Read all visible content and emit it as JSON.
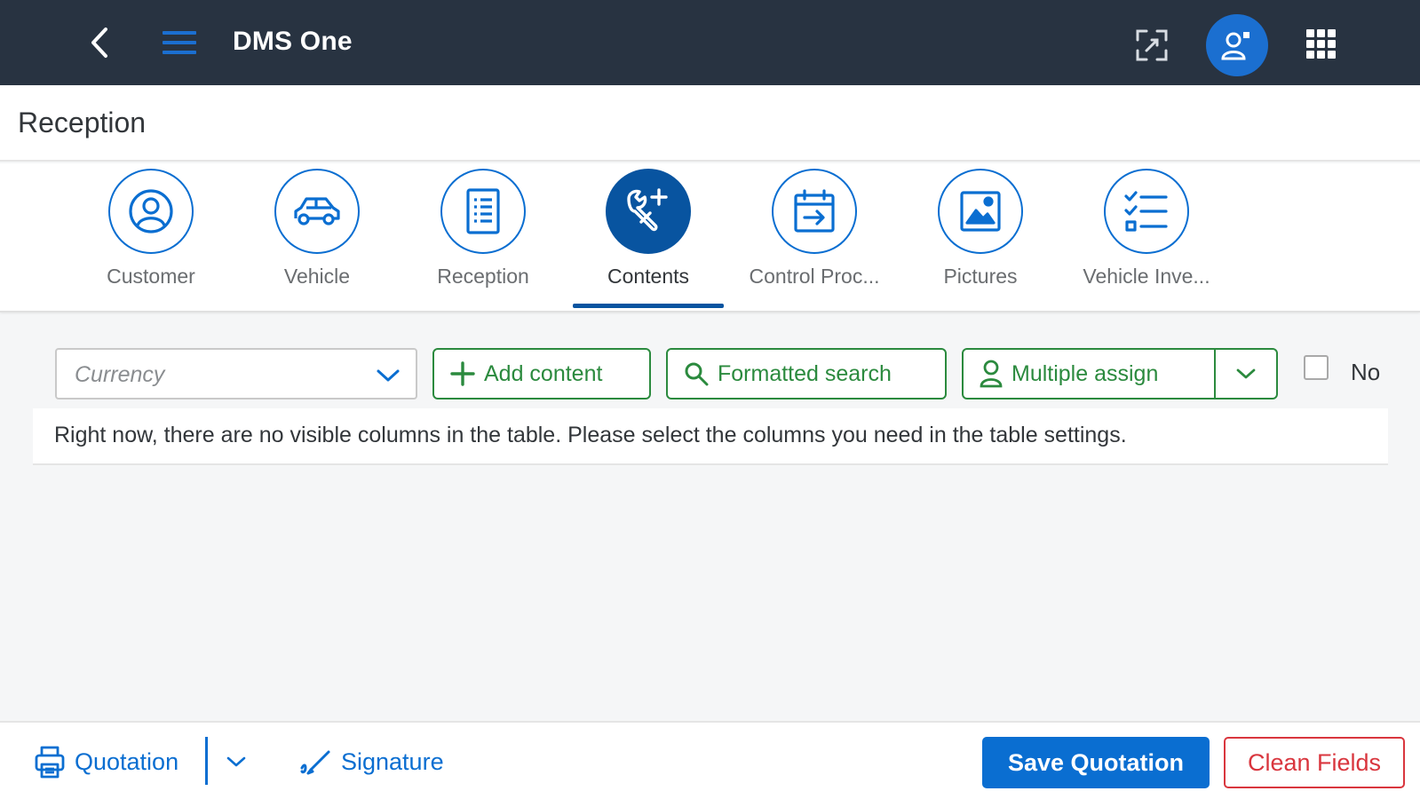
{
  "shell": {
    "title": "DMS One",
    "icons": {
      "back": "back-arrow-icon",
      "menu": "hamburger-menu-icon",
      "expand": "full-screen-icon",
      "avatar": "user-avatar-icon",
      "apps": "app-grid-icon"
    }
  },
  "page": {
    "title": "Reception"
  },
  "tabs": [
    {
      "label": "Customer",
      "icon": "customer-icon",
      "active": false
    },
    {
      "label": "Vehicle",
      "icon": "car-icon",
      "active": false
    },
    {
      "label": "Reception",
      "icon": "document-icon",
      "active": false
    },
    {
      "label": "Contents",
      "icon": "tools-add-icon",
      "active": true
    },
    {
      "label": "Control Proc...",
      "icon": "calendar-arrow-icon",
      "active": false
    },
    {
      "label": "Pictures",
      "icon": "picture-icon",
      "active": false
    },
    {
      "label": "Vehicle Inve...",
      "icon": "checklist-icon",
      "active": false
    }
  ],
  "toolbar": {
    "currency_placeholder": "Currency",
    "add_content": "Add content",
    "formatted_search": "Formatted search",
    "multiple_assign": "Multiple assign",
    "no_label": "No",
    "no_checked": false
  },
  "table": {
    "empty_message": "Right now, there are no visible columns in the table. Please select the columns you need in the table settings."
  },
  "footer": {
    "quotation": "Quotation",
    "signature": "Signature",
    "save_quotation": "Save Quotation",
    "clean_fields": "Clean Fields"
  },
  "colors": {
    "shell_bg": "#283341",
    "brand_blue": "#0a6ed1",
    "active_tab": "#0854a0",
    "positive_green": "#2b8a3e",
    "negative_red": "#d9363e"
  }
}
